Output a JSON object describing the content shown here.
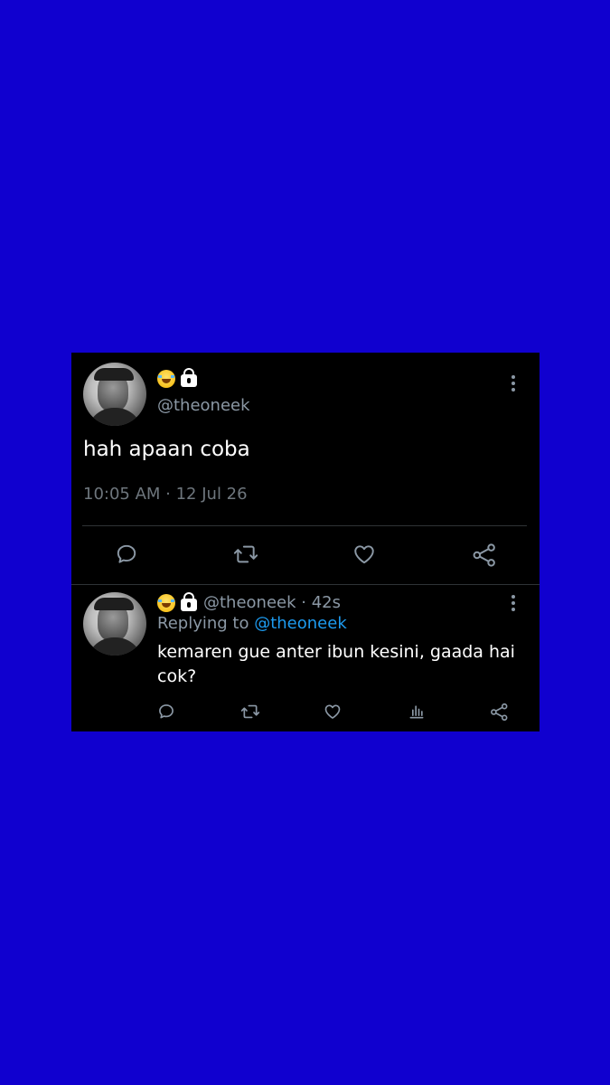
{
  "main_tweet": {
    "handle": "@theoneek",
    "text": "hah apaan coba",
    "timestamp": "10:05 AM · 12 Jul 26",
    "badges": [
      "face-with-tears-of-joy-emoji",
      "lock-icon"
    ]
  },
  "reply_tweet": {
    "handle": "@theoneek",
    "age": "· 42s",
    "replying_to_label": "Replying to",
    "replying_to_handle": "@theoneek",
    "text": "kemaren gue anter ibun kesini, gaada hai cok?"
  },
  "colors": {
    "background": "#1000cf",
    "card": "#000000",
    "muted": "#8b98a5",
    "mention": "#1d9bf0"
  },
  "icons": [
    "reply-icon",
    "retweet-icon",
    "like-icon",
    "share-icon",
    "analytics-icon",
    "more-icon"
  ]
}
